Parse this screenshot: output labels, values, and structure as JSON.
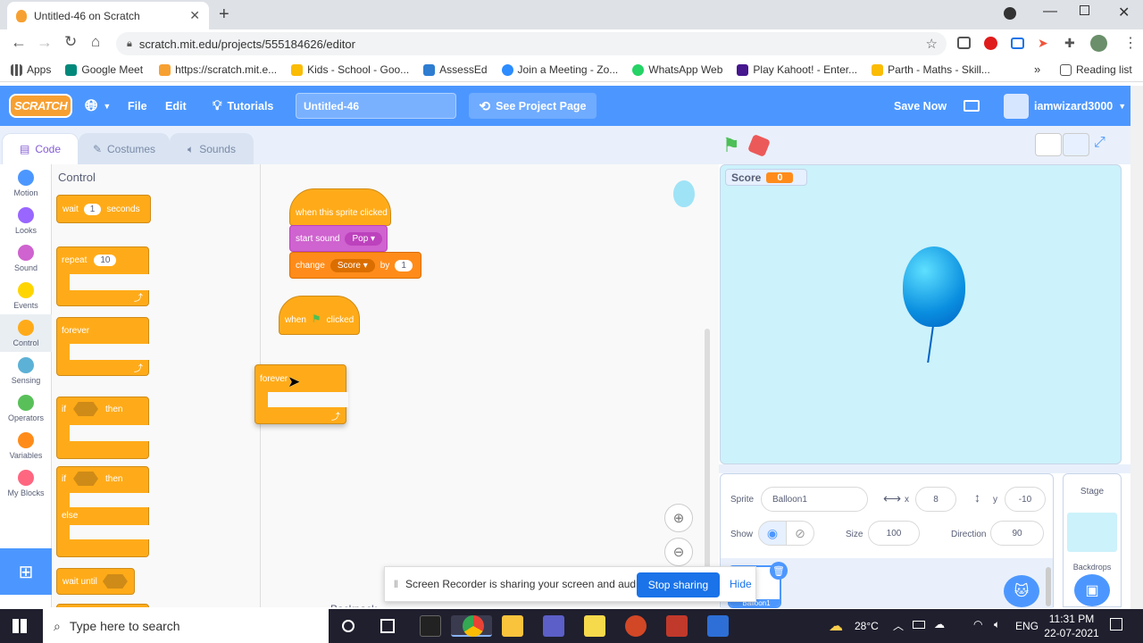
{
  "browser": {
    "tab_title": "Untitled-46 on Scratch",
    "url": "scratch.mit.edu/projects/555184626/editor",
    "bookmarks": [
      "Apps",
      "Google Meet",
      "https://scratch.mit.e...",
      "Kids - School - Goo...",
      "AssessEd",
      "Join a Meeting - Zo...",
      "WhatsApp Web",
      "Play Kahoot! - Enter...",
      "Parth - Maths - Skill..."
    ],
    "reading_list": "Reading list"
  },
  "menu": {
    "logo": "SCRATCH",
    "file": "File",
    "edit": "Edit",
    "tutorials": "Tutorials",
    "project_title": "Untitled-46",
    "see_project": "See Project Page",
    "save_now": "Save Now",
    "username": "iamwizard3000"
  },
  "tabs": {
    "code": "Code",
    "costumes": "Costumes",
    "sounds": "Sounds"
  },
  "categories": [
    {
      "label": "Motion",
      "color": "#4c97ff"
    },
    {
      "label": "Looks",
      "color": "#9966ff"
    },
    {
      "label": "Sound",
      "color": "#cf63cf"
    },
    {
      "label": "Events",
      "color": "#ffd500"
    },
    {
      "label": "Control",
      "color": "#ffab19"
    },
    {
      "label": "Sensing",
      "color": "#5cb1d6"
    },
    {
      "label": "Operators",
      "color": "#59c059"
    },
    {
      "label": "Variables",
      "color": "#ff8c1a"
    },
    {
      "label": "My Blocks",
      "color": "#ff6680"
    }
  ],
  "palette": {
    "heading": "Control",
    "wait": "wait",
    "wait_val": "1",
    "seconds": "seconds",
    "repeat": "repeat",
    "repeat_val": "10",
    "forever": "forever",
    "if": "if",
    "then": "then",
    "if2": "if",
    "then2": "then",
    "else": "else",
    "wait_until": "wait until"
  },
  "scripts": {
    "hat1": "when this sprite clicked",
    "start_sound": "start sound",
    "sound_val": "Pop",
    "change": "change",
    "var_val": "Score",
    "by": "by",
    "by_val": "1",
    "when": "when",
    "clicked": "clicked",
    "forever": "forever",
    "backpack": "Backpack"
  },
  "stage": {
    "score_label": "Score",
    "score_value": "0"
  },
  "sprite_info": {
    "sprite_label": "Sprite",
    "sprite_name": "Balloon1",
    "x_label": "x",
    "x_val": "8",
    "y_label": "y",
    "y_val": "-10",
    "show_label": "Show",
    "size_label": "Size",
    "size_val": "100",
    "direction_label": "Direction",
    "direction_val": "90",
    "sprite_thumb_label": "Balloon1"
  },
  "stage_panel": {
    "title": "Stage",
    "backdrops": "Backdrops"
  },
  "banner": {
    "text": "Screen Recorder is sharing your screen and audio.",
    "stop": "Stop sharing",
    "hide": "Hide"
  },
  "taskbar": {
    "search": "Type here to search",
    "weather": "28°C",
    "lang": "ENG",
    "time": "11:31 PM",
    "date": "22-07-2021"
  }
}
